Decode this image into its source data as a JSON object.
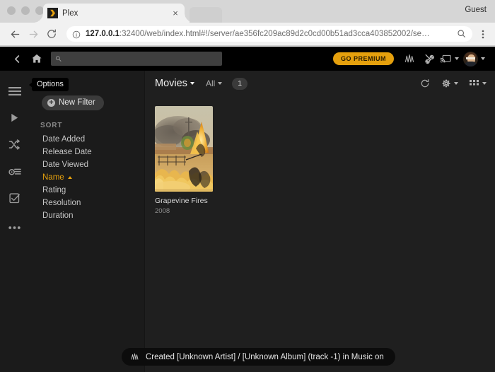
{
  "browser": {
    "tab": {
      "title": "Plex",
      "favicon": "plex-chevron-icon",
      "close": "×"
    },
    "guest_label": "Guest",
    "omnibox": {
      "host": "127.0.0.1",
      "rest": ":32400/web/index.html#!/server/ae356fc209ac89d2c0cd00b51ad3cca403852002/se…",
      "full_url": "127.0.0.1:32400/web/index.html#!/server/ae356fc209ac89d2c0cd00b51ad3cca403852002/se…",
      "info_icon": "info-circle-icon",
      "search_icon": "search-icon"
    },
    "nav": {
      "back": "back-arrow-icon",
      "forward": "forward-arrow-icon",
      "reload": "reload-icon",
      "menu": "kebab-menu-icon"
    }
  },
  "plex_header": {
    "back_icon": "chevron-left-icon",
    "home_icon": "home-icon",
    "search_placeholder": "",
    "search_value": "",
    "search_icon": "search-icon",
    "premium_label": "GO PREMIUM",
    "activity_icon": "activity-pulse-icon",
    "tools_icon": "wrench-screwdriver-icon",
    "cast_icon": "cast-icon",
    "avatar": "user-avatar"
  },
  "rail": {
    "items": [
      {
        "icon": "hamburger-menu-icon",
        "name": "sidebar-item-menu"
      },
      {
        "icon": "play-icon",
        "name": "sidebar-item-play"
      },
      {
        "icon": "shuffle-icon",
        "name": "sidebar-item-shuffle"
      },
      {
        "icon": "playlist-add-icon",
        "name": "sidebar-item-playlist"
      },
      {
        "icon": "checkbox-check-icon",
        "name": "sidebar-item-select"
      },
      {
        "icon": "ellipsis-icon",
        "name": "sidebar-item-more"
      }
    ]
  },
  "options": {
    "tooltip": "Options",
    "new_filter_label": "New Filter",
    "new_filter_icon": "plus-circle-icon",
    "sort_heading": "SORT",
    "sort_items": [
      {
        "label": "Date Added",
        "active": false
      },
      {
        "label": "Release Date",
        "active": false
      },
      {
        "label": "Date Viewed",
        "active": false
      },
      {
        "label": "Name",
        "active": true,
        "direction": "asc"
      },
      {
        "label": "Rating",
        "active": false
      },
      {
        "label": "Resolution",
        "active": false
      },
      {
        "label": "Duration",
        "active": false
      }
    ]
  },
  "content_bar": {
    "library_title": "Movies",
    "filter_label": "All",
    "count": "1",
    "refresh_icon": "refresh-icon",
    "settings_icon": "gear-icon",
    "layout_icon": "grid-layout-icon"
  },
  "library": {
    "items": [
      {
        "title": "Grapevine Fires",
        "year": "2008",
        "art": "wildfire-landscape-painting"
      }
    ]
  },
  "toast": {
    "icon": "activity-pulse-icon",
    "message": "Created [Unknown Artist] / [Unknown Album] (track -1) in Music on"
  },
  "colors": {
    "accent": "#e5a00d",
    "app_bg": "#1f1f1f",
    "rail_bg": "#1b1b1b",
    "header_bg": "#000000",
    "chrome_bg": "#d6d6d6"
  }
}
